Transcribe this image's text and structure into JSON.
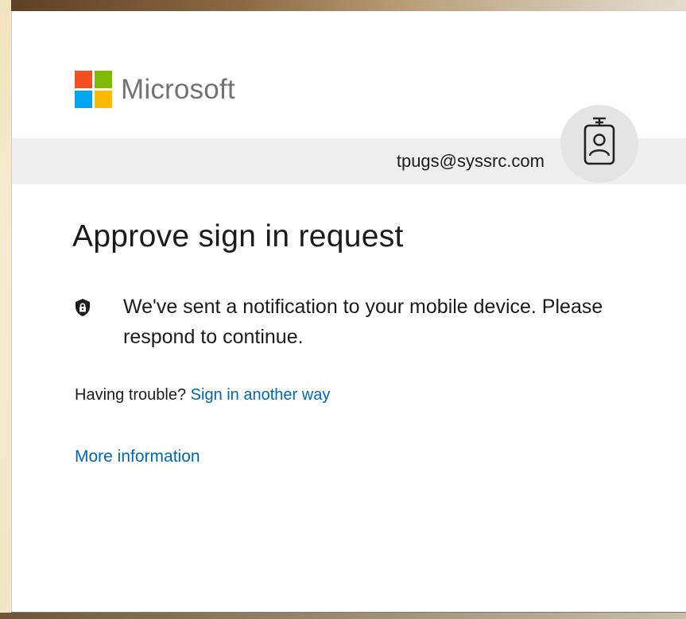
{
  "brand": {
    "name": "Microsoft",
    "logo_colors": {
      "red": "#f25022",
      "green": "#7fba00",
      "blue": "#00a4ef",
      "yellow": "#ffb900"
    }
  },
  "identity": {
    "email": "tpugs@syssrc.com",
    "badge_icon": "id-badge-icon"
  },
  "main": {
    "title": "Approve sign in request",
    "notice_icon": "shield-lock-icon",
    "notice_text": "We've sent a notification to your mobile device. Please respond to continue.",
    "trouble_prefix": "Having trouble?",
    "sign_in_another_way": "Sign in another way",
    "more_information": "More information"
  },
  "colors": {
    "link": "#0067b8",
    "text": "#1b1b1b",
    "identity_strip": "#efefef"
  }
}
